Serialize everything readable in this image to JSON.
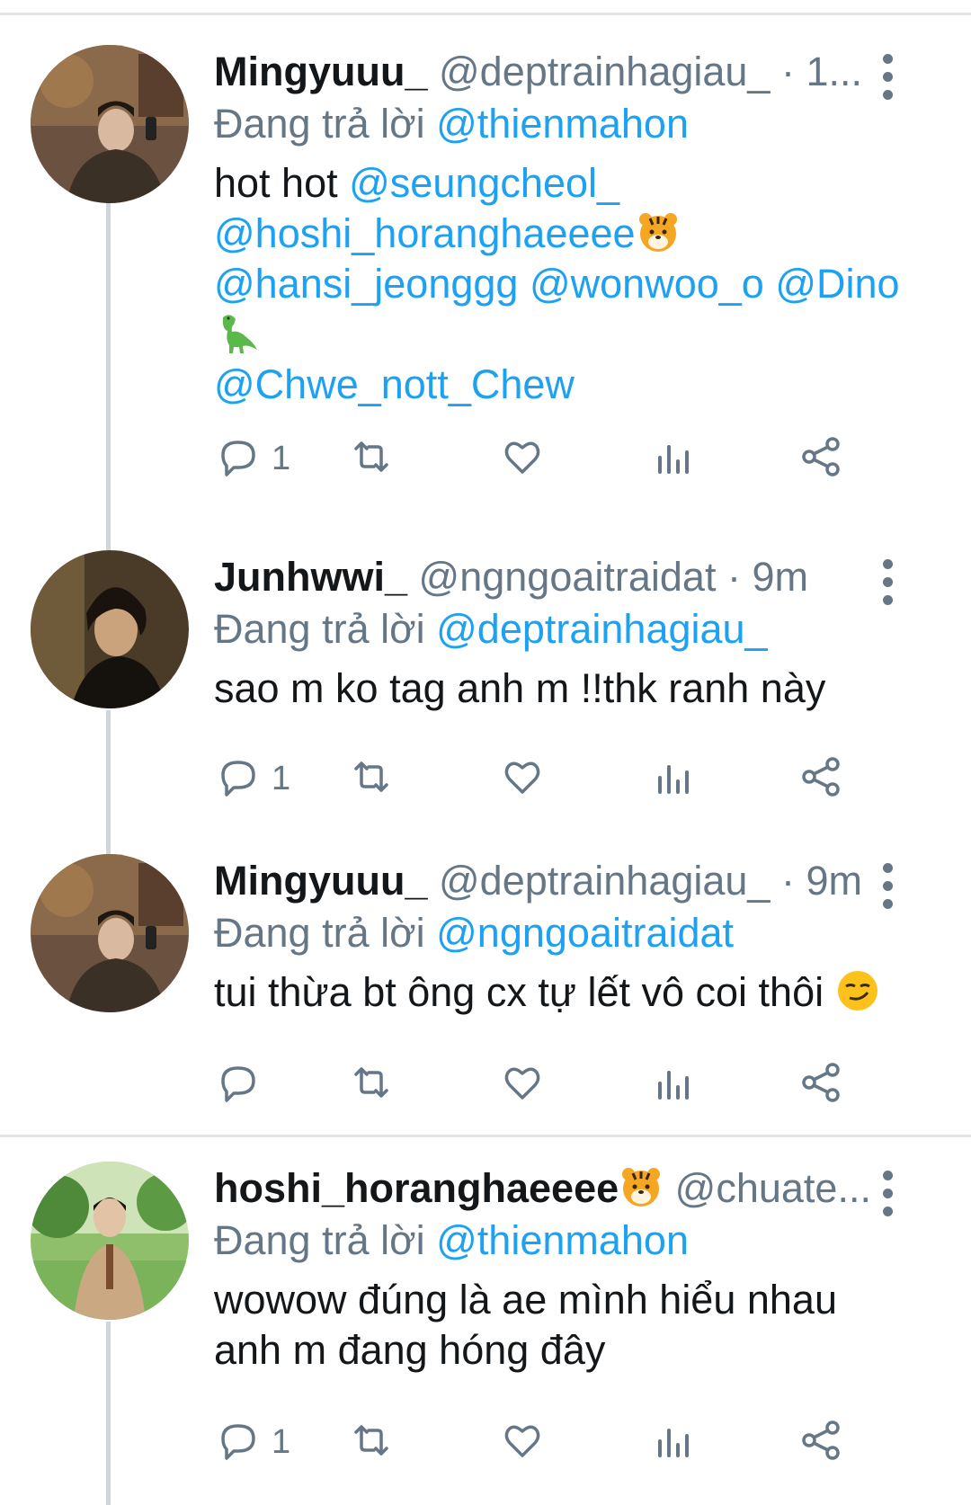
{
  "tweets": [
    {
      "display_name": "Mingyuuu_",
      "handle": "@deptrainhagiau_",
      "sep": "·",
      "time": "1...",
      "replying_label": "Đang trả lời",
      "replying_to": "@thienmahon",
      "body_lines": [
        [
          {
            "t": "hot hot "
          },
          {
            "t": "@seungcheol_",
            "m": true
          }
        ],
        [
          {
            "t": "@hoshi_horanghaeeee",
            "m": true
          },
          {
            "e": "tiger-face"
          }
        ],
        [
          {
            "t": "@hansi_jeonggg",
            "m": true
          },
          {
            "t": " "
          },
          {
            "t": "@wonwoo_o",
            "m": true
          },
          {
            "t": " "
          },
          {
            "t": "@Dino",
            "m": true
          }
        ],
        [
          {
            "e": "dinosaur"
          }
        ],
        [
          {
            "t": "@Chwe_nott_Chew",
            "m": true
          }
        ]
      ],
      "replies": "1"
    },
    {
      "display_name": "Junhwwi_",
      "handle": "@ngngoaitraidat",
      "sep": "·",
      "time": "9m",
      "replying_label": "Đang trả lời",
      "replying_to": "@deptrainhagiau_",
      "body_lines": [
        [
          {
            "t": "sao m ko tag anh m !!thk ranh này"
          }
        ]
      ],
      "replies": "1"
    },
    {
      "display_name": "Mingyuuu_",
      "handle": "@deptrainhagiau_",
      "sep": "·",
      "time": "9m",
      "replying_label": "Đang trả lời",
      "replying_to": "@ngngoaitraidat",
      "body_lines": [
        [
          {
            "t": "tui thừa bt ông cx tự lết vô coi thôi "
          },
          {
            "e": "smirking-face"
          }
        ]
      ],
      "replies": ""
    },
    {
      "display_name": "hoshi_horanghaeeee",
      "handle": "@chuate...",
      "sep": "",
      "time": "",
      "name_emoji": "tiger-face",
      "replying_label": "Đang trả lời",
      "replying_to": "@thienmahon",
      "body_lines": [
        [
          {
            "t": "wowow đúng là ae mình hiểu nhau"
          }
        ],
        [
          {
            "t": "anh m đang hóng đây"
          }
        ]
      ],
      "replies": "1"
    }
  ],
  "colors": {
    "mention": "#1da1f2",
    "secondary_text": "#657786",
    "icon": "#657786",
    "divider": "#e1e4e6"
  },
  "icons": [
    "reply-icon",
    "retweet-icon",
    "like-icon",
    "analytics-icon",
    "share-icon",
    "more-options-icon"
  ]
}
